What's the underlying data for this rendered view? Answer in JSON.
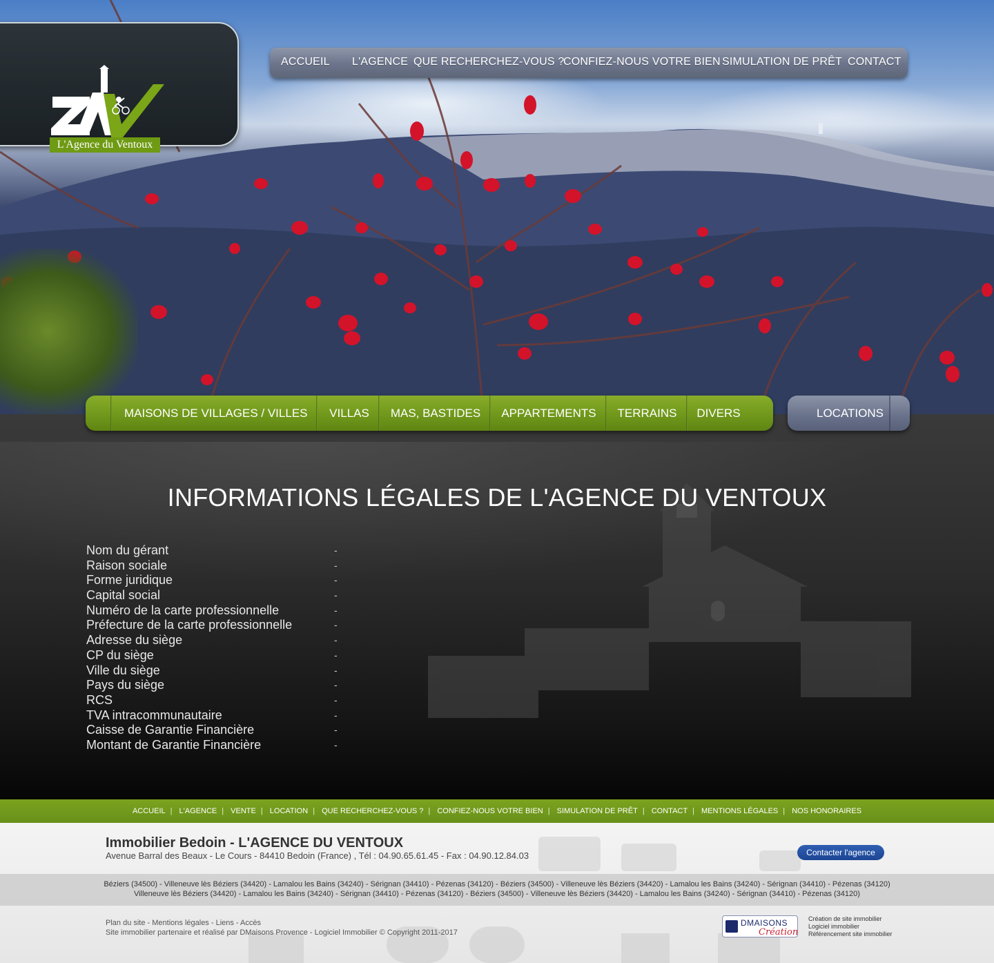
{
  "logo": {
    "caption": "L'Agence du Ventoux",
    "brand_letters": "AV"
  },
  "top_nav": {
    "items": [
      "ACCUEIL",
      "L'AGENCE",
      "QUE RECHERCHEZ-VOUS ?",
      "CONFIEZ-NOUS VOTRE BIEN",
      "SIMULATION DE PRÊT",
      "CONTACT"
    ]
  },
  "categories": {
    "items": [
      "MAISONS DE VILLAGES / VILLES",
      "VILLAS",
      "MAS, BASTIDES",
      "APPARTEMENTS",
      "TERRAINS",
      "DIVERS"
    ],
    "locations": "LOCATIONS"
  },
  "page": {
    "title": "INFORMATIONS LÉGALES DE L'AGENCE DU VENTOUX",
    "legal": [
      {
        "label": "Nom du gérant",
        "value": "-"
      },
      {
        "label": "Raison sociale",
        "value": "-"
      },
      {
        "label": "Forme juridique",
        "value": "-"
      },
      {
        "label": "Capital social",
        "value": "-"
      },
      {
        "label": "Numéro de la carte professionnelle",
        "value": "-"
      },
      {
        "label": "Préfecture de la carte professionnelle",
        "value": "-"
      },
      {
        "label": "Adresse du siège",
        "value": "-"
      },
      {
        "label": "CP du siège",
        "value": "-"
      },
      {
        "label": "Ville du siège",
        "value": "-"
      },
      {
        "label": "Pays du siège",
        "value": "-"
      },
      {
        "label": "RCS",
        "value": "-"
      },
      {
        "label": "TVA intracommunautaire",
        "value": "-"
      },
      {
        "label": "Caisse de Garantie Financière",
        "value": "-"
      },
      {
        "label": "Montant de Garantie Financière",
        "value": "-"
      }
    ]
  },
  "footer_nav": {
    "items": [
      "ACCUEIL",
      "L'AGENCE",
      "VENTE",
      "LOCATION",
      "QUE RECHERCHEZ-VOUS ?",
      "CONFIEZ-NOUS VOTRE BIEN",
      "SIMULATION DE PRÊT",
      "CONTACT",
      "MENTIONS LÉGALES",
      "NOS HONORAIRES"
    ],
    "separator": "|"
  },
  "footer": {
    "agency_name": "Immobilier Bedoin - L'AGENCE DU VENTOUX",
    "address": "Avenue Barral des Beaux - Le Cours - 84410 Bedoin (France) , Tél : 04.90.65.61.45 - Fax : 04.90.12.84.03",
    "contact_button": "Contacter l'agence",
    "cities_line1": "Béziers (34500) - Villeneuve lès Béziers (34420) - Lamalou les Bains (34240) - Sérignan (34410) - Pézenas (34120) - Béziers (34500) - Villeneuve lès Béziers (34420) - Lamalou les Bains (34240) - Sérignan (34410) - Pézenas (34120)",
    "cities_line2": "Villeneuve lès Béziers (34420) - Lamalou les Bains (34240) - Sérignan (34410) - Pézenas (34120) - Béziers (34500) - Villeneuve lès Béziers (34420) - Lamalou les Bains (34240) - Sérignan (34410) - Pézenas (34120)",
    "links_line": "Plan du site - Mentions légales - Liens - Accès",
    "credit_line": "Site immobilier partenaire et réalisé par DMaisons Provence - Logiciel Immobilier © Copyright 2011-2017",
    "dm_name": "DMAISONS",
    "dm_sub": "Création",
    "dm_text": [
      "Création de site immobilier",
      "Logiciel immobilier",
      "Référencement site immobilier"
    ]
  }
}
